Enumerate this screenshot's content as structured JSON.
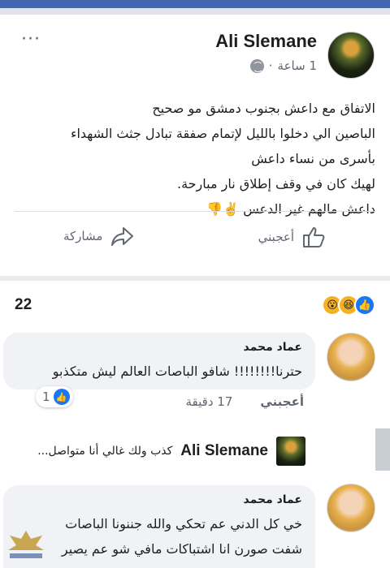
{
  "post": {
    "author": "Ali Slemane",
    "time": "1 ساعة",
    "visibility_icon": "globe-icon",
    "more_label": "···",
    "text_lines": [
      "الاتفاق مع داعش بجنوب دمشق مو صحيح",
      "الباصين الي دخلوا بالليل لإتمام صفقة تبادل جثث الشهداء",
      "بأسرى من نساء داعش",
      "لهيك كان في وقف إطلاق نار مبارحة.",
      "داعش مالهم غير الدعس ✌️👎"
    ],
    "actions": {
      "like_label": "أعجبني",
      "share_label": "مشاركة"
    }
  },
  "reactions": {
    "count": "22",
    "types": [
      "like-icon",
      "haha-icon",
      "wow-icon"
    ]
  },
  "comments": [
    {
      "author": "عماد محمد",
      "text": "حترنا!!!!!!!! شافو الباصات العالم ليش متكذبو",
      "time": "17 دقيقة",
      "like_label": "أعجبني",
      "like_count": "1"
    },
    {
      "author": "عماد محمد",
      "text_lines": [
        "خي كل الدني عم تحكي والله جننونا الباصات",
        "شفت صورن انا اشتباكات مافي شو عم يصير"
      ]
    }
  ],
  "reply": {
    "author": "Ali Slemane",
    "text": "كذب ولك غالي أنا متواصل..."
  },
  "colors": {
    "brand": "#4267b2",
    "like_blue": "#1877f2",
    "bubble": "#f0f2f5"
  }
}
